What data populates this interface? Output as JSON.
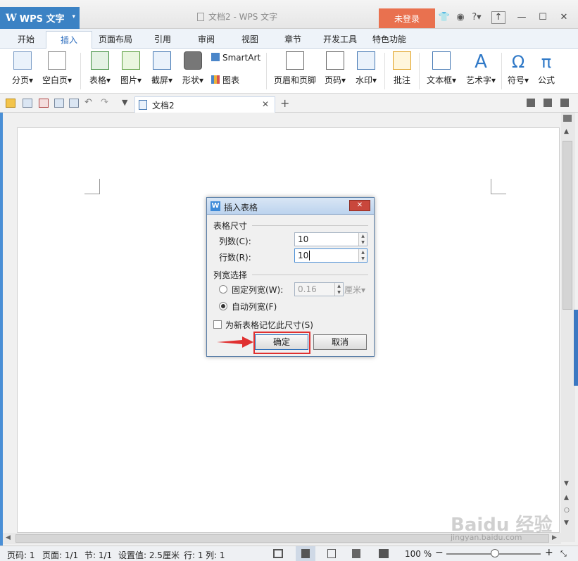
{
  "app": {
    "name": "WPS 文字",
    "doc_title": "文档2 - WPS 文字",
    "login_label": "未登录"
  },
  "tabs": [
    "开始",
    "插入",
    "页面布局",
    "引用",
    "审阅",
    "视图",
    "章节",
    "开发工具",
    "特色功能"
  ],
  "ribbon": {
    "page_break": "分页",
    "blank_page": "空白页",
    "table": "表格",
    "picture": "图片",
    "screenshot": "截屏",
    "shapes": "形状",
    "smartart": "SmartArt",
    "chart": "图表",
    "header_footer": "页眉和页脚",
    "page_number": "页码",
    "watermark": "水印",
    "comment": "批注",
    "text_box": "文本框",
    "word_art": "艺术字",
    "symbol": "符号",
    "formula": "公式",
    "symbol_glyph": "Ω",
    "formula_glyph": "π",
    "wordart_glyph": "A",
    "dropdown_glyph": "▾"
  },
  "doc_tab": {
    "name": "文档2"
  },
  "dialog": {
    "title": "插入表格",
    "table_size_label": "表格尺寸",
    "columns_label": "列数(C):",
    "columns_value": "10",
    "rows_label": "行数(R):",
    "rows_value": "10",
    "column_width_label": "列宽选择",
    "fixed_width_label": "固定列宽(W):",
    "fixed_width_value": "0.16",
    "fixed_width_unit": "厘米▾",
    "auto_width_label": "自动列宽(F)",
    "remember_label": "为新表格记忆此尺寸(S)",
    "ok_label": "确定",
    "cancel_label": "取消",
    "selected_width_option": "auto",
    "remember_checked": false
  },
  "status": {
    "page": "页码: 1",
    "pages": "页面: 1/1",
    "section": "节: 1/1",
    "setting": "设置值: 2.5厘米",
    "line": "行: 1",
    "column": "列: 1",
    "zoom": "100 %",
    "zoom_minus": "−",
    "zoom_plus": "+"
  },
  "watermark": {
    "text": "Baidu 经验",
    "url": "jingyan.baidu.com"
  },
  "colors": {
    "accent": "#3b82c4",
    "login": "#e9714f",
    "highlight": "#e03030"
  }
}
